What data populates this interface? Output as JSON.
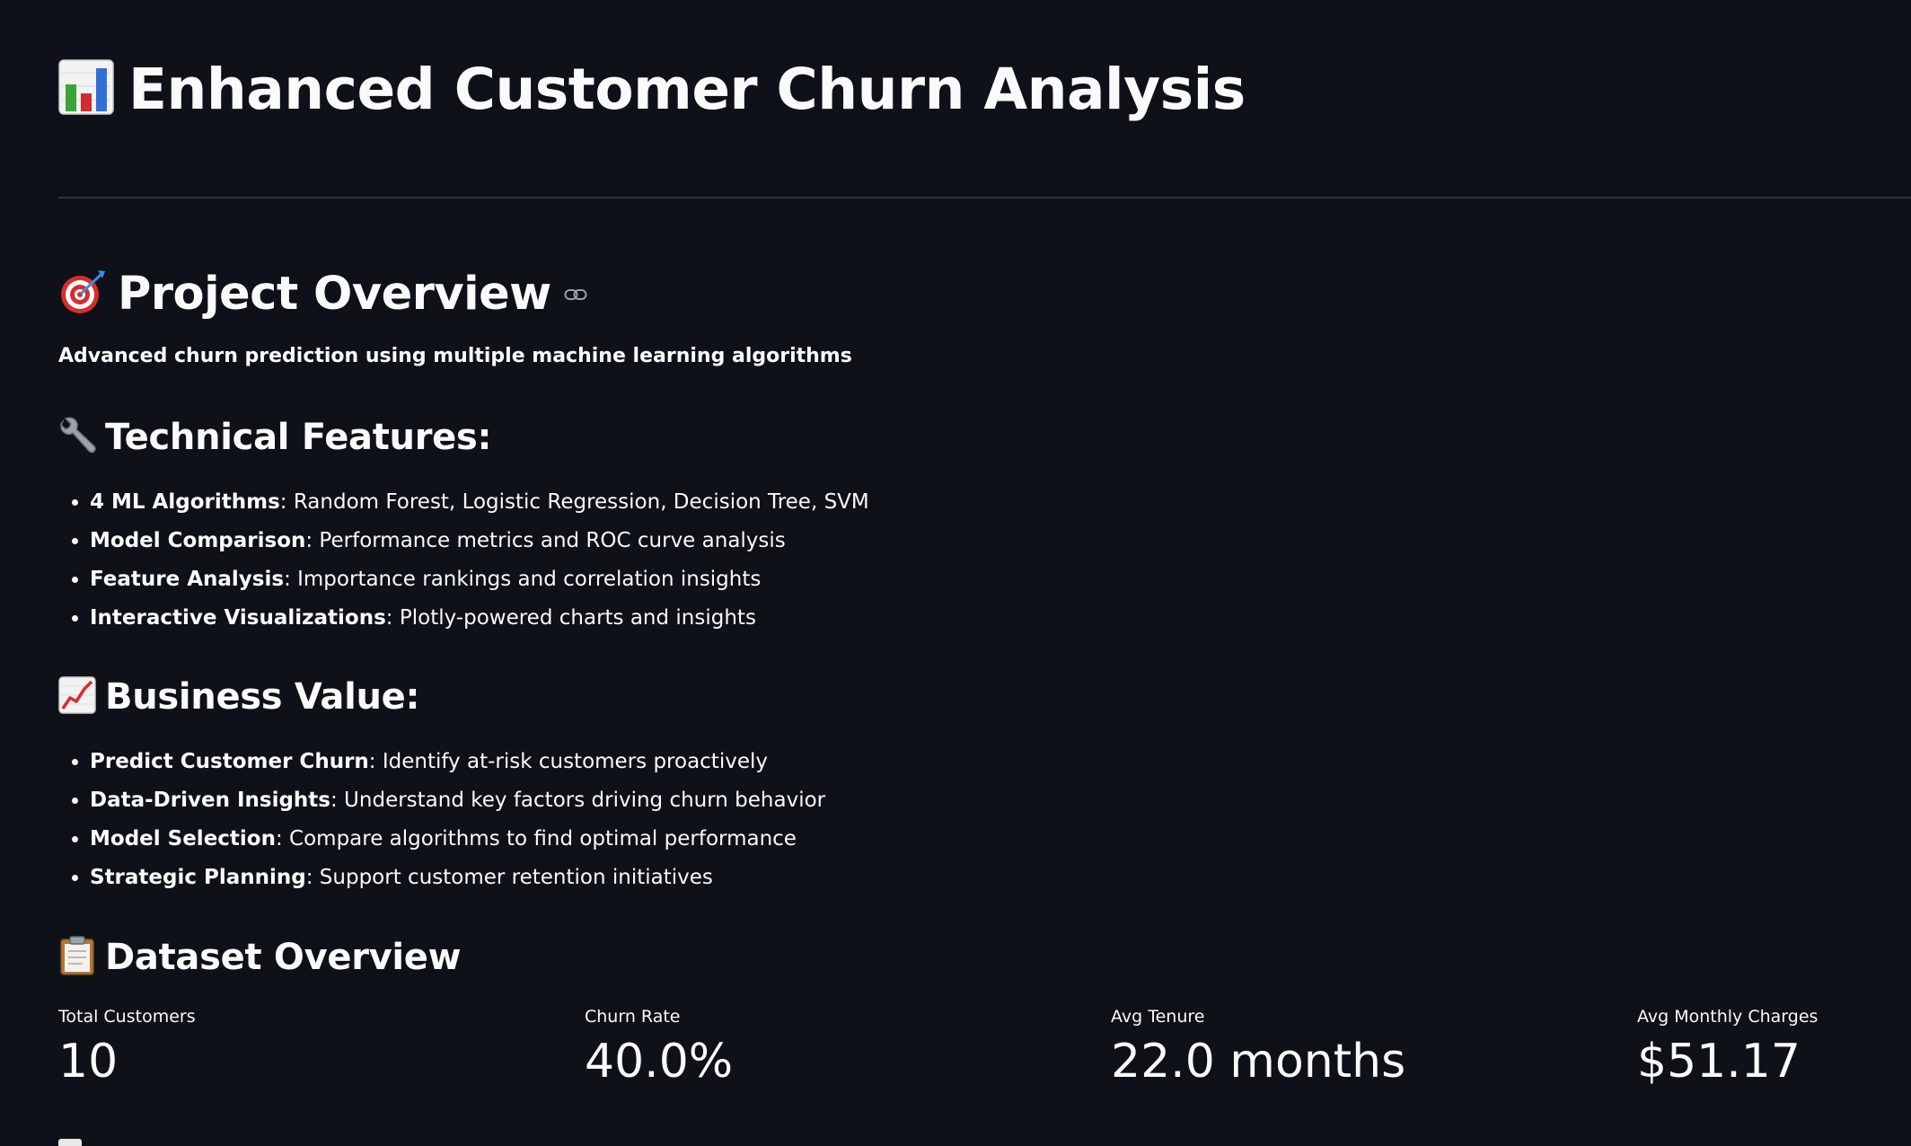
{
  "header": {
    "title": "Enhanced Customer Churn Analysis",
    "icon": "bar-chart-icon"
  },
  "overview": {
    "heading": "Project Overview",
    "icon": "target-icon",
    "tagline": "Advanced churn prediction using multiple machine learning algorithms"
  },
  "technical": {
    "heading": "Technical Features:",
    "icon": "wrench-icon",
    "items": [
      {
        "bold": "4 ML Algorithms",
        "text": ": Random Forest, Logistic Regression, Decision Tree, SVM"
      },
      {
        "bold": "Model Comparison",
        "text": ": Performance metrics and ROC curve analysis"
      },
      {
        "bold": "Feature Analysis",
        "text": ": Importance rankings and correlation insights"
      },
      {
        "bold": "Interactive Visualizations",
        "text": ": Plotly-powered charts and insights"
      }
    ]
  },
  "business": {
    "heading": "Business Value:",
    "icon": "chart-increasing-icon",
    "items": [
      {
        "bold": "Predict Customer Churn",
        "text": ": Identify at-risk customers proactively"
      },
      {
        "bold": "Data-Driven Insights",
        "text": ": Understand key factors driving churn behavior"
      },
      {
        "bold": "Model Selection",
        "text": ": Compare algorithms to find optimal performance"
      },
      {
        "bold": "Strategic Planning",
        "text": ": Support customer retention initiatives"
      }
    ]
  },
  "dataset": {
    "heading": "Dataset Overview",
    "icon": "clipboard-icon",
    "metrics": [
      {
        "label": "Total Customers",
        "value": "10"
      },
      {
        "label": "Churn Rate",
        "value": "40.0%"
      },
      {
        "label": "Avg Tenure",
        "value": "22.0 months"
      },
      {
        "label": "Avg Monthly Charges",
        "value": "$51.17"
      }
    ]
  },
  "colors": {
    "background": "#0e1117",
    "text": "#fafafa",
    "divider": "#31333f"
  }
}
